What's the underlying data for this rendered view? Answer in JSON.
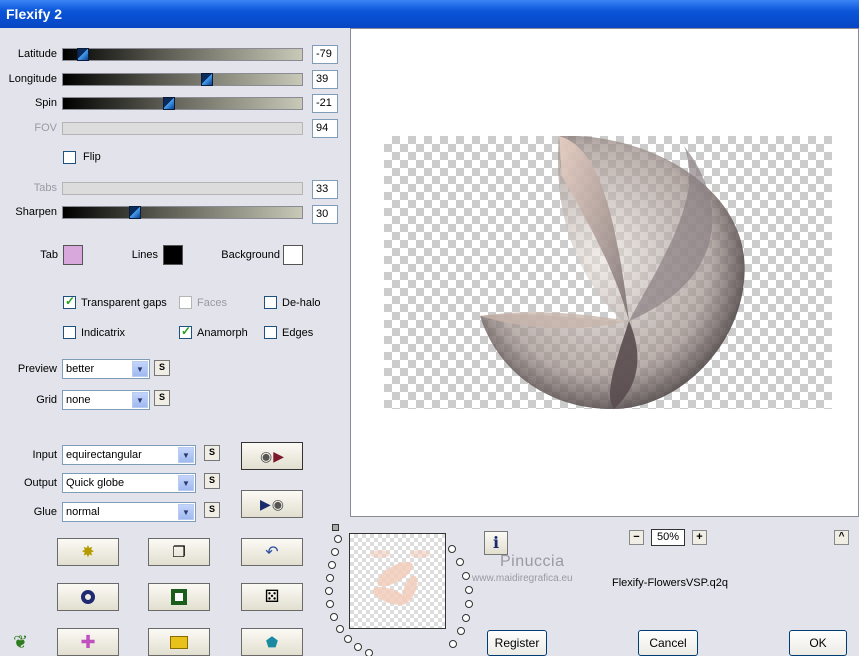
{
  "window": {
    "title": "Flexify 2"
  },
  "sliders": [
    {
      "label": "Latitude",
      "value": "-79",
      "disabled": false,
      "fraction": 0.06
    },
    {
      "label": "Longitude",
      "value": "39",
      "disabled": false,
      "fraction": 0.61
    },
    {
      "label": "Spin",
      "value": "-21",
      "disabled": false,
      "fraction": 0.44
    },
    {
      "label": "FOV",
      "value": "94",
      "disabled": true
    },
    {
      "label": "Tabs",
      "value": "33",
      "disabled": true
    },
    {
      "label": "Sharpen",
      "value": "30",
      "disabled": false,
      "fraction": 0.29
    }
  ],
  "flip": {
    "label": "Flip",
    "checked": false
  },
  "colors": {
    "tab": {
      "label": "Tab",
      "color": "#d8a8dc"
    },
    "lines": {
      "label": "Lines",
      "color": "#000000"
    },
    "background": {
      "label": "Background",
      "color": "#ffffff"
    }
  },
  "options": {
    "transparent_gaps": {
      "label": "Transparent gaps",
      "checked": true
    },
    "faces": {
      "label": "Faces",
      "checked": false,
      "disabled": true
    },
    "dehalo": {
      "label": "De-halo",
      "checked": false
    },
    "indicatrix": {
      "label": "Indicatrix",
      "checked": false
    },
    "anamorph": {
      "label": "Anamorph",
      "checked": true
    },
    "edges": {
      "label": "Edges",
      "checked": false
    }
  },
  "preview_quality": {
    "label": "Preview",
    "value": "better",
    "s": "S"
  },
  "grid": {
    "label": "Grid",
    "value": "none",
    "s": "S"
  },
  "input": {
    "label": "Input",
    "value": "equirectangular",
    "s": "S"
  },
  "output": {
    "label": "Output",
    "value": "Quick globe",
    "s": "S"
  },
  "glue": {
    "label": "Glue",
    "value": "normal",
    "s": "S"
  },
  "status": {
    "zoom": "50%",
    "zoom_minus": "−",
    "zoom_plus": "+",
    "filename": "Flexify-FlowersVSP.q2q",
    "info_icon": "i",
    "scroll_up": "^"
  },
  "watermark": {
    "name": "Pinuccia",
    "site": "www.maidiregrafica.eu"
  },
  "buttons": {
    "register": "Register",
    "cancel": "Cancel",
    "ok": "OK"
  }
}
